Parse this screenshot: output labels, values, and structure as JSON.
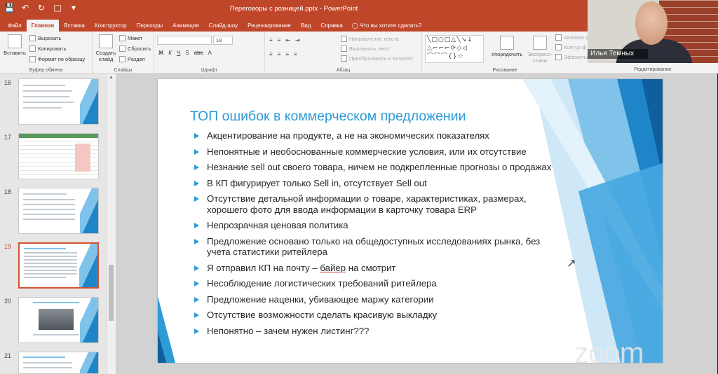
{
  "titlebar": {
    "doc_title": "Переговоры с розницей.pptx  -  PowerPoint"
  },
  "tabs": [
    "Файл",
    "Главная",
    "Вставка",
    "Конструктор",
    "Переходы",
    "Анимация",
    "Слайд-шоу",
    "Рецензирование",
    "Вид",
    "Справка"
  ],
  "tell_me": "Что вы хотите сделать?",
  "ribbon": {
    "paste": "Вставить",
    "cut": "Вырезать",
    "copy": "Копировать",
    "format_painter": "Формат по образцу",
    "clipboard_label": "Буфер обмена",
    "new_slide": "Создать слайд",
    "layout": "Макет",
    "reset": "Сбросить",
    "section": "Раздел",
    "slides_label": "Слайды",
    "font_size": "18",
    "font_label": "Шрифт",
    "text_direction": "Направление текста",
    "align_text": "Выровнять текст",
    "convert_smartart": "Преобразовать в SmartArt",
    "paragraph_label": "Абзац",
    "arrange": "Упорядочить",
    "quick_styles": "Экспресс-стили",
    "shape_fill": "Заливка ф",
    "shape_outline": "Контур ф",
    "shape_effects": "Эффекты",
    "drawing_label": "Рисование",
    "editing_label": "Редактирование"
  },
  "thumbnails": [
    {
      "num": "16"
    },
    {
      "num": "17"
    },
    {
      "num": "18"
    },
    {
      "num": "19"
    },
    {
      "num": "20"
    },
    {
      "num": "21"
    }
  ],
  "slide": {
    "title": "ТОП ошибок в коммерческом предложении",
    "bullets": [
      "Акцентирование на продукте, а не на экономических показателях",
      "Непонятные и необоснованные коммерческие условия, или их отсутствие",
      "Незнание sell out своего товара, ничем не подкрепленные прогнозы о продажах",
      "В КП фигурирует только Sell in, отсутствует Sell out",
      "Отсутствие детальной информации о товаре, характеристиках, размерах, хорошего фото для ввода информации в карточку товара ERP",
      "Непрозрачная ценовая политика",
      "Предложение основано только на общедоступных исследованиях рынка, без учета статистики ритейлера",
      "Несоблюдение логистических требований ритейлера",
      "Предложение наценки, убивающее маржу категории",
      "Отсутствие возможности сделать красивую выкладку",
      "Непонятно – зачем нужен листинг???"
    ],
    "bullet_8_pre": "Я отправил КП на почту – ",
    "bullet_8_link": "байер",
    "bullet_8_post": " на смотрит"
  },
  "webcam": {
    "participant": "Илья Темных"
  },
  "zoom_logo": "zoom",
  "colors": {
    "accent": "#c0462a",
    "slide_title": "#2d9bd6"
  }
}
